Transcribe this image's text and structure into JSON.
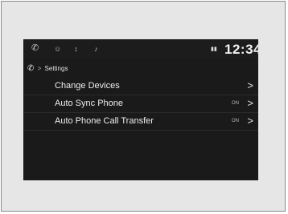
{
  "status_bar": {
    "icons": [
      "phone-icon",
      "person-icon",
      "usb-icon",
      "media-icon"
    ],
    "clock": "12:34"
  },
  "breadcrumb": {
    "icon": "phone-icon",
    "separator": ">",
    "label": "Settings"
  },
  "menu": {
    "items": [
      {
        "label": "Change Devices",
        "value": "",
        "chevron": ">"
      },
      {
        "label": "Auto Sync Phone",
        "value": "ON",
        "chevron": ">"
      },
      {
        "label": "Auto Phone Call Transfer",
        "value": "ON",
        "chevron": ">"
      }
    ]
  },
  "colors": {
    "screen_background": "#1a1a1a",
    "text": "#ededed",
    "frame": "#e6e6e6"
  }
}
